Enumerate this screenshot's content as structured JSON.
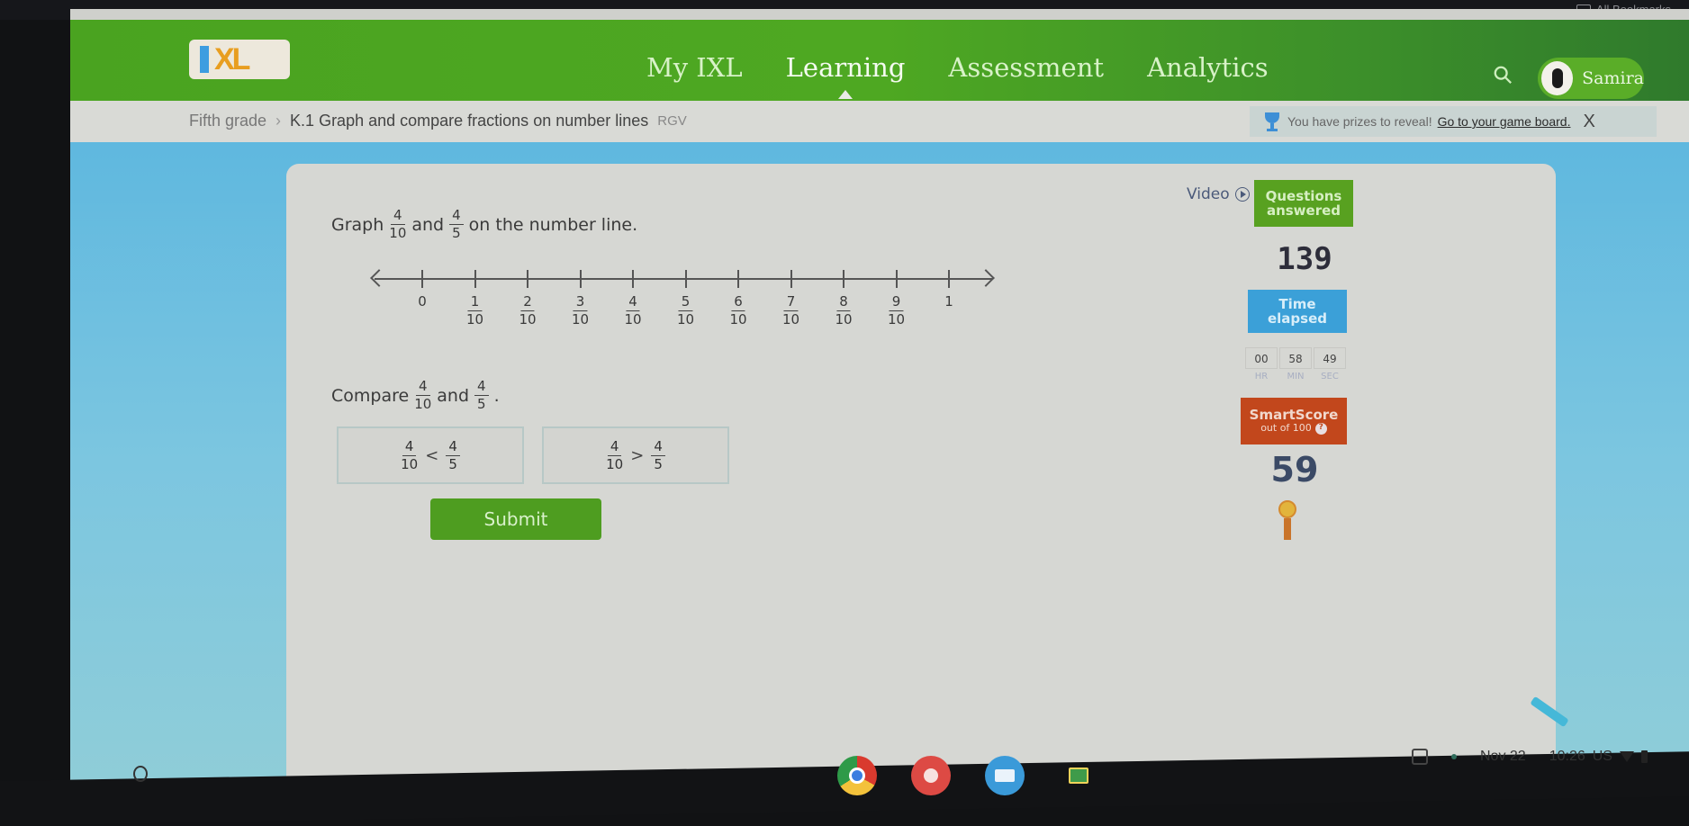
{
  "browser": {
    "bookmarks_label": "All Bookmarks"
  },
  "header": {
    "logo": "IXL",
    "nav": [
      {
        "label": "My IXL",
        "active": false
      },
      {
        "label": "Learning",
        "active": true
      },
      {
        "label": "Assessment",
        "active": false
      },
      {
        "label": "Analytics",
        "active": false
      }
    ],
    "user_name": "Samira",
    "brand_color": "#4aa320"
  },
  "breadcrumb": {
    "grade": "Fifth grade",
    "separator": "›",
    "skill": "K.1 Graph and compare fractions on number lines",
    "tag": "RGV"
  },
  "prize_banner": {
    "text": "You have prizes to reveal!",
    "link": "Go to your game board.",
    "close": "X"
  },
  "question": {
    "graph_prefix": "Graph",
    "graph_and": "and",
    "graph_suffix": "on the number line.",
    "fraction_a": {
      "num": "4",
      "den": "10"
    },
    "fraction_b": {
      "num": "4",
      "den": "5"
    },
    "number_line": {
      "ticks": [
        {
          "num": "0",
          "den": ""
        },
        {
          "num": "1",
          "den": "10"
        },
        {
          "num": "2",
          "den": "10"
        },
        {
          "num": "3",
          "den": "10"
        },
        {
          "num": "4",
          "den": "10"
        },
        {
          "num": "5",
          "den": "10"
        },
        {
          "num": "6",
          "den": "10"
        },
        {
          "num": "7",
          "den": "10"
        },
        {
          "num": "8",
          "den": "10"
        },
        {
          "num": "9",
          "den": "10"
        },
        {
          "num": "1",
          "den": ""
        }
      ]
    },
    "compare_prefix": "Compare",
    "compare_and": "and",
    "compare_suffix": ".",
    "choices": [
      {
        "left_num": "4",
        "left_den": "10",
        "op": "<",
        "right_num": "4",
        "right_den": "5"
      },
      {
        "left_num": "4",
        "left_den": "10",
        "op": ">",
        "right_num": "4",
        "right_den": "5"
      }
    ],
    "submit_label": "Submit"
  },
  "sidebar": {
    "video_label": "Video",
    "questions_answered_label_1": "Questions",
    "questions_answered_label_2": "answered",
    "questions_answered": "139",
    "time_elapsed_label_1": "Time",
    "time_elapsed_label_2": "elapsed",
    "timer": [
      {
        "value": "00",
        "unit": "HR"
      },
      {
        "value": "58",
        "unit": "MIN"
      },
      {
        "value": "49",
        "unit": "SEC"
      }
    ],
    "smartscore_label": "SmartScore",
    "smartscore_sub": "out of 100",
    "smartscore_help": "?",
    "smartscore": "59",
    "colors": {
      "questions": "#58a120",
      "time": "#3ba0d8",
      "smartscore": "#c2471c"
    }
  },
  "shelf": {
    "apps": [
      "Chrome",
      "Paint",
      "Cards",
      "Classroom"
    ],
    "date": "Nov 22",
    "time": "10:26",
    "locale": "US"
  }
}
